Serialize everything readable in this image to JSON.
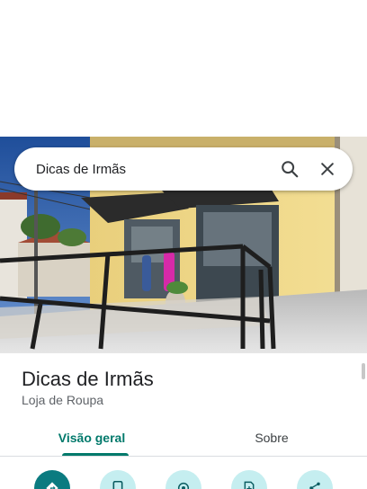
{
  "search": {
    "query": "Dicas de Irmãs",
    "search_icon": "search-icon",
    "clear_icon": "close-icon"
  },
  "place": {
    "name": "Dicas de Irmãs",
    "category": "Loja de Roupa"
  },
  "tabs": [
    {
      "label": "Visão geral",
      "selected": true
    },
    {
      "label": "Sobre",
      "selected": false
    }
  ],
  "actions": [
    {
      "icon": "directions-icon"
    },
    {
      "icon": "phone-icon"
    },
    {
      "icon": "location-icon"
    },
    {
      "icon": "save-icon"
    },
    {
      "icon": "share-icon"
    }
  ],
  "colors": {
    "accent": "#00796b",
    "primary_action": "#0b7b80",
    "secondary_action": "#c5eef0",
    "wall": "#f0d98a",
    "sky": "#2c5fa8"
  }
}
